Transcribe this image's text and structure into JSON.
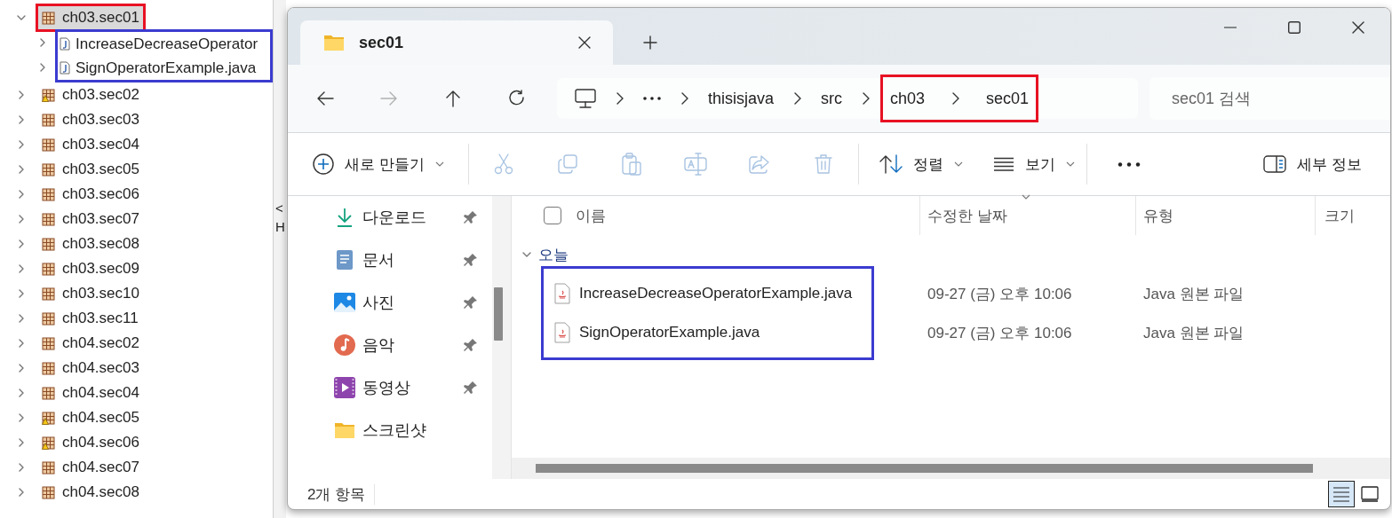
{
  "ide": {
    "tree": [
      {
        "label": "ch03.sec01",
        "expanded": true,
        "warning": false,
        "annotation": {
          "color": "#e81123"
        },
        "children_annotation": {
          "color": "#3b3bd0"
        },
        "children": [
          {
            "label": "IncreaseDecreaseOperator",
            "expanded": false
          },
          {
            "label": "SignOperatorExample.java",
            "expanded": false
          }
        ]
      },
      {
        "label": "ch03.sec02",
        "expanded": false,
        "warning": true
      },
      {
        "label": "ch03.sec03",
        "expanded": false,
        "warning": false
      },
      {
        "label": "ch03.sec04",
        "expanded": false,
        "warning": false
      },
      {
        "label": "ch03.sec05",
        "expanded": false,
        "warning": false
      },
      {
        "label": "ch03.sec06",
        "expanded": false,
        "warning": false
      },
      {
        "label": "ch03.sec07",
        "expanded": false,
        "warning": false
      },
      {
        "label": "ch03.sec08",
        "expanded": false,
        "warning": false
      },
      {
        "label": "ch03.sec09",
        "expanded": false,
        "warning": false
      },
      {
        "label": "ch03.sec10",
        "expanded": false,
        "warning": false
      },
      {
        "label": "ch03.sec11",
        "expanded": false,
        "warning": false
      },
      {
        "label": "ch04.sec02",
        "expanded": false,
        "warning": false
      },
      {
        "label": "ch04.sec03",
        "expanded": false,
        "warning": false
      },
      {
        "label": "ch04.sec04",
        "expanded": false,
        "warning": false
      },
      {
        "label": "ch04.sec05",
        "expanded": false,
        "warning": true
      },
      {
        "label": "ch04.sec06",
        "expanded": false,
        "warning": true
      },
      {
        "label": "ch04.sec07",
        "expanded": false,
        "warning": false
      },
      {
        "label": "ch04.sec08",
        "expanded": false,
        "warning": false
      }
    ],
    "side_texts": [
      "<",
      "H"
    ]
  },
  "explorer": {
    "tabs": [
      {
        "label": "sec01",
        "selected": true
      }
    ],
    "nav": [
      {
        "kind": "back",
        "disabled": false
      },
      {
        "kind": "forward",
        "disabled": true
      },
      {
        "kind": "up",
        "disabled": false
      },
      {
        "kind": "refresh",
        "disabled": false
      }
    ],
    "breadcrumb": [
      {
        "label": "thisisjava"
      },
      {
        "label": "src"
      },
      {
        "label": "ch03",
        "annotation": {
          "color": "#e81123"
        }
      },
      {
        "label": "sec01",
        "annotation": {
          "color": "#e81123"
        }
      }
    ],
    "search": {
      "placeholder": "sec01 검색"
    },
    "toolbar": [
      {
        "kind": "new",
        "label": "새로 만들기",
        "dropdown": true,
        "disabled": false
      },
      {
        "kind": "separator"
      },
      {
        "kind": "cut",
        "disabled": true
      },
      {
        "kind": "copy",
        "disabled": true
      },
      {
        "kind": "paste",
        "disabled": true
      },
      {
        "kind": "rename",
        "disabled": true
      },
      {
        "kind": "share",
        "disabled": true
      },
      {
        "kind": "delete",
        "disabled": true
      },
      {
        "kind": "separator"
      },
      {
        "kind": "sort",
        "label": "정렬",
        "dropdown": true,
        "disabled": false
      },
      {
        "kind": "view",
        "label": "보기",
        "dropdown": true,
        "disabled": false
      },
      {
        "kind": "separator"
      },
      {
        "kind": "more"
      },
      {
        "kind": "details",
        "label": "세부 정보",
        "disabled": false
      }
    ],
    "nav_pane": [
      {
        "kind": "download",
        "label": "다운로드",
        "pinned": true
      },
      {
        "kind": "document",
        "label": "문서",
        "pinned": true
      },
      {
        "kind": "picture",
        "label": "사진",
        "pinned": true
      },
      {
        "kind": "music",
        "label": "음악",
        "pinned": true
      },
      {
        "kind": "video",
        "label": "동영상",
        "pinned": true
      },
      {
        "kind": "folder",
        "label": "스크린샷",
        "pinned": false
      }
    ],
    "select_all": {
      "checked": false
    },
    "columns": [
      {
        "label": "이름"
      },
      {
        "label": "수정한 날짜",
        "sorted": true
      },
      {
        "label": "유형"
      },
      {
        "label": "크기"
      }
    ],
    "group": {
      "label": "오늘",
      "expanded": true
    },
    "files_annotation": {
      "color": "#3b3bd0"
    },
    "files": [
      {
        "name": "IncreaseDecreaseOperatorExample.java",
        "modified": "09-27 (금) 오후 10:06",
        "type": "Java 원본 파일"
      },
      {
        "name": "SignOperatorExample.java",
        "modified": "09-27 (금) 오후 10:06",
        "type": "Java 원본 파일"
      }
    ],
    "status": {
      "count": "2개 항목",
      "views": [
        {
          "kind": "details",
          "selected": true
        },
        {
          "kind": "tiles",
          "selected": false
        }
      ]
    }
  }
}
